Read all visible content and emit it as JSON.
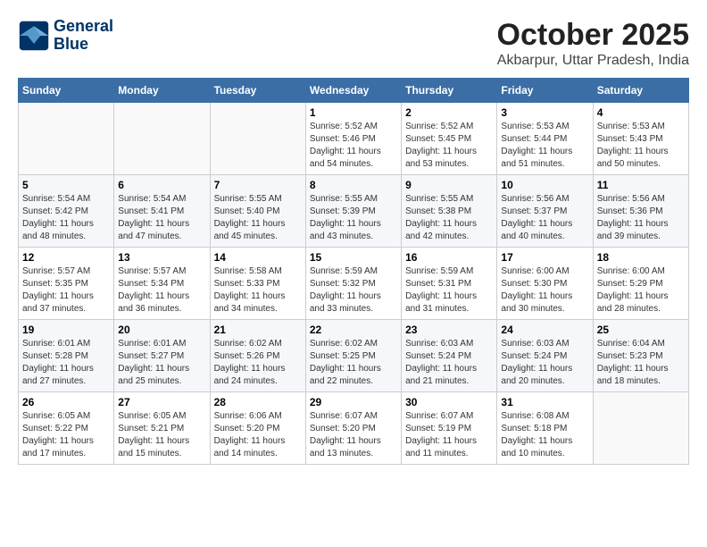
{
  "logo": {
    "line1": "General",
    "line2": "Blue"
  },
  "title": "October 2025",
  "location": "Akbarpur, Uttar Pradesh, India",
  "weekdays": [
    "Sunday",
    "Monday",
    "Tuesday",
    "Wednesday",
    "Thursday",
    "Friday",
    "Saturday"
  ],
  "weeks": [
    [
      {
        "day": "",
        "info": ""
      },
      {
        "day": "",
        "info": ""
      },
      {
        "day": "",
        "info": ""
      },
      {
        "day": "1",
        "info": "Sunrise: 5:52 AM\nSunset: 5:46 PM\nDaylight: 11 hours\nand 54 minutes."
      },
      {
        "day": "2",
        "info": "Sunrise: 5:52 AM\nSunset: 5:45 PM\nDaylight: 11 hours\nand 53 minutes."
      },
      {
        "day": "3",
        "info": "Sunrise: 5:53 AM\nSunset: 5:44 PM\nDaylight: 11 hours\nand 51 minutes."
      },
      {
        "day": "4",
        "info": "Sunrise: 5:53 AM\nSunset: 5:43 PM\nDaylight: 11 hours\nand 50 minutes."
      }
    ],
    [
      {
        "day": "5",
        "info": "Sunrise: 5:54 AM\nSunset: 5:42 PM\nDaylight: 11 hours\nand 48 minutes."
      },
      {
        "day": "6",
        "info": "Sunrise: 5:54 AM\nSunset: 5:41 PM\nDaylight: 11 hours\nand 47 minutes."
      },
      {
        "day": "7",
        "info": "Sunrise: 5:55 AM\nSunset: 5:40 PM\nDaylight: 11 hours\nand 45 minutes."
      },
      {
        "day": "8",
        "info": "Sunrise: 5:55 AM\nSunset: 5:39 PM\nDaylight: 11 hours\nand 43 minutes."
      },
      {
        "day": "9",
        "info": "Sunrise: 5:55 AM\nSunset: 5:38 PM\nDaylight: 11 hours\nand 42 minutes."
      },
      {
        "day": "10",
        "info": "Sunrise: 5:56 AM\nSunset: 5:37 PM\nDaylight: 11 hours\nand 40 minutes."
      },
      {
        "day": "11",
        "info": "Sunrise: 5:56 AM\nSunset: 5:36 PM\nDaylight: 11 hours\nand 39 minutes."
      }
    ],
    [
      {
        "day": "12",
        "info": "Sunrise: 5:57 AM\nSunset: 5:35 PM\nDaylight: 11 hours\nand 37 minutes."
      },
      {
        "day": "13",
        "info": "Sunrise: 5:57 AM\nSunset: 5:34 PM\nDaylight: 11 hours\nand 36 minutes."
      },
      {
        "day": "14",
        "info": "Sunrise: 5:58 AM\nSunset: 5:33 PM\nDaylight: 11 hours\nand 34 minutes."
      },
      {
        "day": "15",
        "info": "Sunrise: 5:59 AM\nSunset: 5:32 PM\nDaylight: 11 hours\nand 33 minutes."
      },
      {
        "day": "16",
        "info": "Sunrise: 5:59 AM\nSunset: 5:31 PM\nDaylight: 11 hours\nand 31 minutes."
      },
      {
        "day": "17",
        "info": "Sunrise: 6:00 AM\nSunset: 5:30 PM\nDaylight: 11 hours\nand 30 minutes."
      },
      {
        "day": "18",
        "info": "Sunrise: 6:00 AM\nSunset: 5:29 PM\nDaylight: 11 hours\nand 28 minutes."
      }
    ],
    [
      {
        "day": "19",
        "info": "Sunrise: 6:01 AM\nSunset: 5:28 PM\nDaylight: 11 hours\nand 27 minutes."
      },
      {
        "day": "20",
        "info": "Sunrise: 6:01 AM\nSunset: 5:27 PM\nDaylight: 11 hours\nand 25 minutes."
      },
      {
        "day": "21",
        "info": "Sunrise: 6:02 AM\nSunset: 5:26 PM\nDaylight: 11 hours\nand 24 minutes."
      },
      {
        "day": "22",
        "info": "Sunrise: 6:02 AM\nSunset: 5:25 PM\nDaylight: 11 hours\nand 22 minutes."
      },
      {
        "day": "23",
        "info": "Sunrise: 6:03 AM\nSunset: 5:24 PM\nDaylight: 11 hours\nand 21 minutes."
      },
      {
        "day": "24",
        "info": "Sunrise: 6:03 AM\nSunset: 5:24 PM\nDaylight: 11 hours\nand 20 minutes."
      },
      {
        "day": "25",
        "info": "Sunrise: 6:04 AM\nSunset: 5:23 PM\nDaylight: 11 hours\nand 18 minutes."
      }
    ],
    [
      {
        "day": "26",
        "info": "Sunrise: 6:05 AM\nSunset: 5:22 PM\nDaylight: 11 hours\nand 17 minutes."
      },
      {
        "day": "27",
        "info": "Sunrise: 6:05 AM\nSunset: 5:21 PM\nDaylight: 11 hours\nand 15 minutes."
      },
      {
        "day": "28",
        "info": "Sunrise: 6:06 AM\nSunset: 5:20 PM\nDaylight: 11 hours\nand 14 minutes."
      },
      {
        "day": "29",
        "info": "Sunrise: 6:07 AM\nSunset: 5:20 PM\nDaylight: 11 hours\nand 13 minutes."
      },
      {
        "day": "30",
        "info": "Sunrise: 6:07 AM\nSunset: 5:19 PM\nDaylight: 11 hours\nand 11 minutes."
      },
      {
        "day": "31",
        "info": "Sunrise: 6:08 AM\nSunset: 5:18 PM\nDaylight: 11 hours\nand 10 minutes."
      },
      {
        "day": "",
        "info": ""
      }
    ]
  ]
}
